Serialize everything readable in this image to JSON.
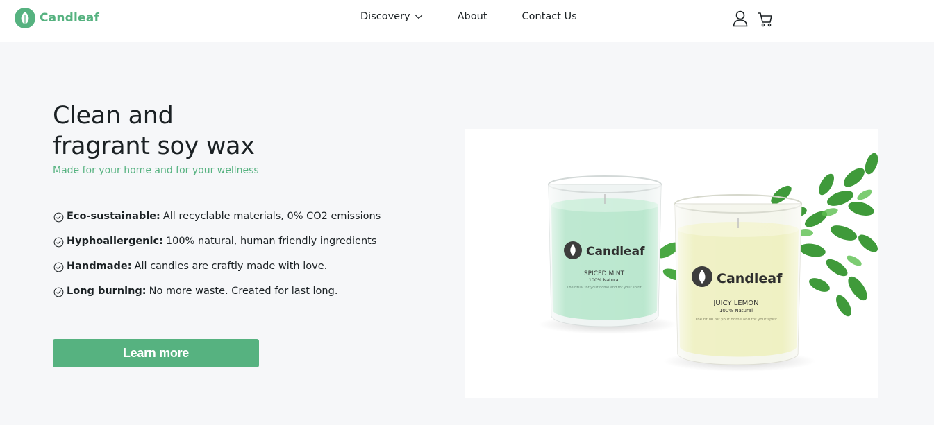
{
  "brand": {
    "name": "Candleaf",
    "color": "#56b280"
  },
  "nav": {
    "discovery": "Discovery",
    "about": "About",
    "contact": "Contact Us"
  },
  "header_icons": [
    "user-icon",
    "cart-icon"
  ],
  "hero": {
    "title_line1": "Clean and",
    "title_line2": "fragrant soy wax",
    "subtitle": "Made for your home and for your wellness",
    "features": [
      {
        "title": "Eco-sustainable:",
        "text": "All recyclable materials, 0% CO2 emissions"
      },
      {
        "title": "Hyphoallergenic:",
        "text": "100% natural, human friendly ingredients"
      },
      {
        "title": "Handmade:",
        "text": "All candles are craftly made with love."
      },
      {
        "title": "Long burning:",
        "text": "No more waste. Created for last long."
      }
    ],
    "cta": "Learn more"
  },
  "product_image": {
    "candle1": {
      "brand": "Candleaf",
      "name": "SPICED MINT",
      "tag": "100% Natural",
      "desc": "The ritual for your home and for your spirit",
      "color": "#b7e6cc"
    },
    "candle2": {
      "brand": "Candleaf",
      "name": "JUICY LEMON",
      "tag": "100% Natural",
      "desc": "The ritual for your home and for your spirit",
      "color": "#eef0c0"
    }
  }
}
